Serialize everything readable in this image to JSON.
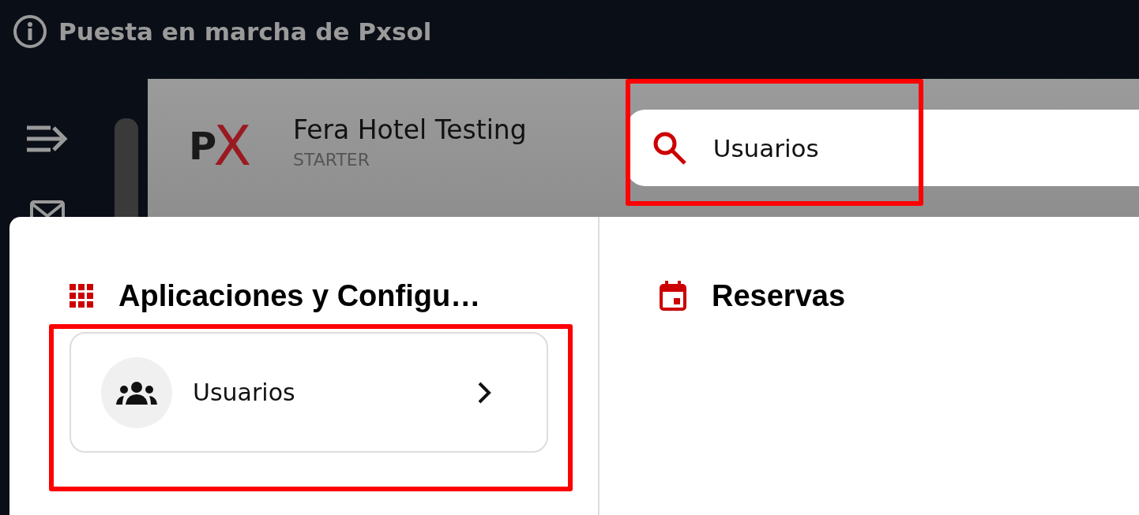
{
  "top_bar": {
    "title": "Puesta en marcha de Pxsol"
  },
  "header": {
    "logo": [
      "P",
      "X"
    ],
    "hotel_name": "Fera Hotel Testing",
    "plan": "STARTER"
  },
  "search": {
    "value": "Usuarios"
  },
  "results": [
    {
      "kind": "apps",
      "title": "Aplicaciones y Configu…",
      "items": [
        {
          "label": "Usuarios"
        }
      ]
    },
    {
      "kind": "bookings",
      "title": "Reservas"
    }
  ]
}
